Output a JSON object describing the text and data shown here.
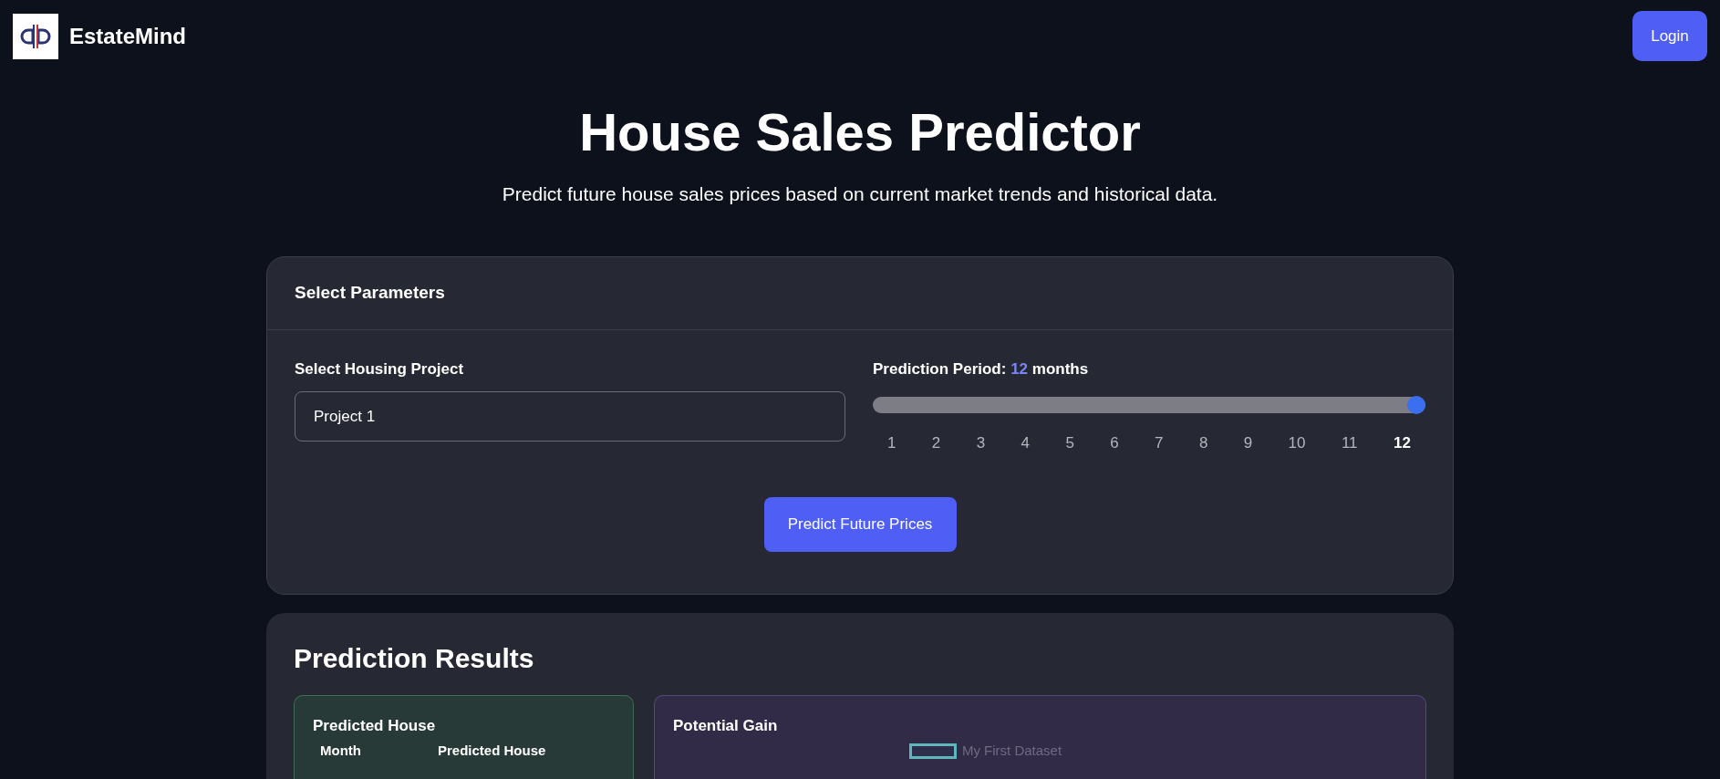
{
  "header": {
    "brand": "EstateMind",
    "login": "Login"
  },
  "hero": {
    "title": "House Sales Predictor",
    "subtitle": "Predict future house sales prices based on current market trends and historical data."
  },
  "parameters": {
    "title": "Select Parameters",
    "project_label": "Select Housing Project",
    "project_value": "Project 1",
    "period_label": "Prediction Period:",
    "period_value": "12",
    "period_unit": "months",
    "level": 1,
    "ticks": [
      {
        "label": "1",
        "selected": false
      },
      {
        "label": "2",
        "selected": false
      },
      {
        "label": "3",
        "selected": false
      },
      {
        "label": "4",
        "selected": false
      },
      {
        "label": "5",
        "selected": false
      },
      {
        "label": "6",
        "selected": false
      },
      {
        "label": "7",
        "selected": false
      },
      {
        "label": "8",
        "selected": false
      },
      {
        "label": "9",
        "selected": false
      },
      {
        "label": "10",
        "selected": false
      },
      {
        "label": "11",
        "selected": false
      },
      {
        "label": "12",
        "selected": true
      }
    ],
    "button": "Predict Future Prices"
  },
  "results": {
    "title": "Prediction Results",
    "predicted": {
      "title": "Predicted House",
      "columns": [
        "Month",
        "Predicted House"
      ]
    },
    "gain": {
      "title": "Potential Gain",
      "legend": "My First Dataset"
    }
  }
}
